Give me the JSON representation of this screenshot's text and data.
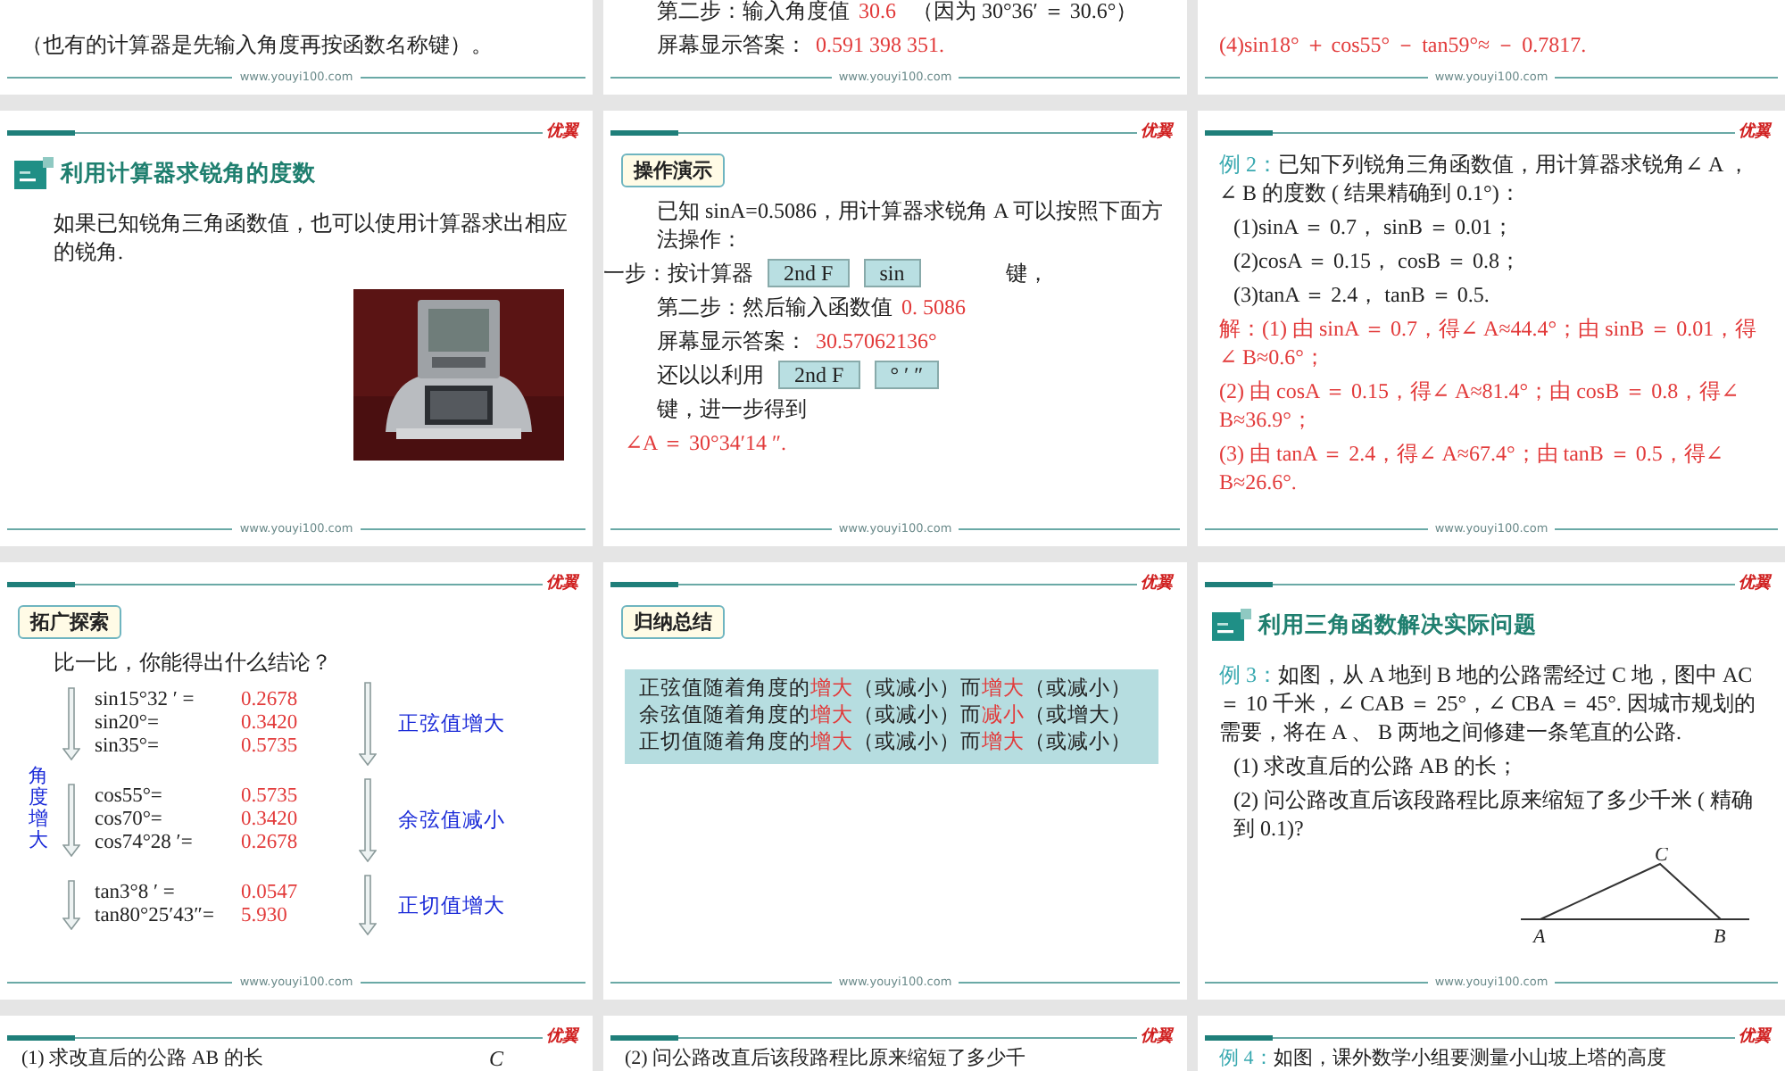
{
  "rows": [
    {
      "slides": [
        {
          "footer": "www.youyi100.com",
          "blocks": [
            {
              "kind": "para",
              "text": "（也有的计算器是先输入角度再按函数名称键）。"
            }
          ]
        },
        {
          "footer": "www.youyi100.com",
          "blocks": [
            {
              "kind": "field",
              "label": "第二步：输入角度值",
              "value": "30.6",
              "note": "（因为 30°36′ ＝ 30.6°）"
            },
            {
              "kind": "field",
              "label": "屏幕显示答案：",
              "value": "0.591 398 351."
            }
          ]
        },
        {
          "footer": "www.youyi100.com",
          "blocks": [
            {
              "kind": "answer",
              "text": "(4)sin18° ＋ cos55° － tan59°≈ － 0.7817."
            }
          ]
        }
      ]
    },
    {
      "slides": [
        {
          "logo": "优翼",
          "footer": "www.youyi100.com",
          "blocks": [
            {
              "kind": "heading",
              "text": "利用计算器求锐角的度数"
            },
            {
              "kind": "lead",
              "text": "如果已知锐角三角函数值，也可以使用计算器求出相应的锐角."
            },
            {
              "kind": "picture"
            }
          ]
        },
        {
          "logo": "优翼",
          "footer": "www.youyi100.com",
          "blocks": [
            {
              "kind": "tag",
              "text": "操作演示"
            },
            {
              "kind": "lead",
              "text": "已知 sinA=0.5086，用计算器求锐角 A 可以按照下面方法操作："
            },
            {
              "kind": "keys",
              "before": "一步：按计算器",
              "keys": [
                "2nd F",
                "sin"
              ],
              "after": "键，"
            },
            {
              "kind": "field",
              "label": "第二步：然后输入函数值",
              "value": "0. 5086"
            },
            {
              "kind": "field",
              "label": "屏幕显示答案：",
              "value": "30.57062136°"
            },
            {
              "kind": "keys",
              "before": "还以以利用",
              "keys": [
                "2nd F",
                "° ′ ″"
              ]
            },
            {
              "kind": "lead",
              "text": "键，进一步得到"
            },
            {
              "kind": "answer",
              "text": "∠A ＝ 30°34′14 ″."
            }
          ]
        },
        {
          "logo": "优翼",
          "footer": "www.youyi100.com",
          "blocks": [
            {
              "kind": "example",
              "label": "例 2：",
              "text": "已知下列锐角三角函数值，用计算器求锐角∠ A ，∠ B 的度数 ( 结果精确到 0.1°)："
            },
            {
              "kind": "item",
              "text": "(1)sinA ＝ 0.7， sinB ＝ 0.01；"
            },
            {
              "kind": "item",
              "text": "(2)cosA ＝ 0.15， cosB ＝ 0.8；"
            },
            {
              "kind": "item",
              "text": "(3)tanA ＝ 2.4， tanB ＝ 0.5."
            },
            {
              "kind": "answer",
              "text": "解：(1) 由 sinA ＝ 0.7，得∠ A≈44.4°；由 sinB ＝ 0.01，得∠ B≈0.6°；"
            },
            {
              "kind": "answer",
              "text": "(2) 由 cosA ＝ 0.15，得∠ A≈81.4°；由 cosB ＝ 0.8，得∠ B≈36.9°；"
            },
            {
              "kind": "answer",
              "text": "(3) 由 tanA ＝ 2.4，得∠ A≈67.4°；由 tanB ＝ 0.5，得∠ B≈26.6°."
            }
          ]
        }
      ]
    },
    {
      "slides": [
        {
          "logo": "优翼",
          "footer": "www.youyi100.com",
          "blocks": [
            {
              "kind": "tag",
              "text": "拓广探索"
            },
            {
              "kind": "lead",
              "text": "比一比，你能得出什么结论？"
            },
            {
              "kind": "compare",
              "side": "角度增大",
              "groups": [
                {
                  "label": "正弦值增大",
                  "rows": [
                    {
                      "expr": "sin15°32 ′ =",
                      "value": "0.2678"
                    },
                    {
                      "expr": "sin20°=",
                      "value": "0.3420"
                    },
                    {
                      "expr": "sin35°=",
                      "value": "0.5735"
                    }
                  ]
                },
                {
                  "label": "余弦值减小",
                  "rows": [
                    {
                      "expr": "cos55°=",
                      "value": "0.5735"
                    },
                    {
                      "expr": "cos70°=",
                      "value": "0.3420"
                    },
                    {
                      "expr": "cos74°28 ′=",
                      "value": "0.2678"
                    }
                  ]
                },
                {
                  "label": "正切值增大",
                  "rows": [
                    {
                      "expr": "tan3°8 ′ =",
                      "value": "0.0547"
                    },
                    {
                      "expr": "tan80°25′43″=",
                      "value": "5.930"
                    }
                  ]
                }
              ]
            }
          ]
        },
        {
          "logo": "优翼",
          "footer": "www.youyi100.com",
          "blocks": [
            {
              "kind": "tag",
              "text": "归纳总结"
            },
            {
              "kind": "summary",
              "lines": [
                [
                  {
                    "text": "正弦值随着角度的"
                  },
                  {
                    "text": "增大",
                    "color": "#e23a3a"
                  },
                  {
                    "text": "（或减小）而"
                  },
                  {
                    "text": "增大",
                    "color": "#e23a3a"
                  },
                  {
                    "text": "（或减小）"
                  }
                ],
                [
                  {
                    "text": "余弦值随着角度的"
                  },
                  {
                    "text": "增大",
                    "color": "#e23a3a"
                  },
                  {
                    "text": "（或减小）而"
                  },
                  {
                    "text": "减小",
                    "color": "#e23a3a"
                  },
                  {
                    "text": "（或增大）"
                  }
                ],
                [
                  {
                    "text": "正切值随着角度的"
                  },
                  {
                    "text": "增大",
                    "color": "#e23a3a"
                  },
                  {
                    "text": "（或减小）而"
                  },
                  {
                    "text": "增大",
                    "color": "#e23a3a"
                  },
                  {
                    "text": "（或减小）"
                  }
                ]
              ]
            }
          ]
        },
        {
          "logo": "优翼",
          "footer": "www.youyi100.com",
          "blocks": [
            {
              "kind": "heading",
              "text": "利用三角函数解决实际问题"
            },
            {
              "kind": "example",
              "label": "例 3：",
              "text": "如图，从 A 地到 B 地的公路需经过 C 地，图中 AC ＝ 10 千米，∠ CAB ＝ 25°，∠ CBA ＝ 45°. 因城市规划的需要，将在 A 、 B 两地之间修建一条笔直的公路."
            },
            {
              "kind": "item",
              "text": "(1) 求改直后的公路 AB 的长；"
            },
            {
              "kind": "item",
              "text": "(2) 问公路改直后该段路程比原来缩短了多少千米 ( 精确到 0.1)?"
            },
            {
              "kind": "triangle",
              "labels": [
                "C",
                "A",
                "B"
              ]
            }
          ]
        }
      ]
    },
    {
      "slides": [
        {
          "logo": "优翼",
          "blocks": [
            {
              "kind": "para",
              "text": "(1) 求改直后的公路 AB 的长",
              "aside": "C"
            }
          ]
        },
        {
          "logo": "优翼",
          "blocks": [
            {
              "kind": "para",
              "text": "(2) 问公路改直后该段路程比原来缩短了多少千"
            }
          ]
        },
        {
          "logo": "优翼",
          "blocks": [
            {
              "kind": "example",
              "label": "例 4：",
              "text": "如图，课外数学小组要测量小山坡上塔的高度"
            }
          ]
        }
      ]
    }
  ]
}
